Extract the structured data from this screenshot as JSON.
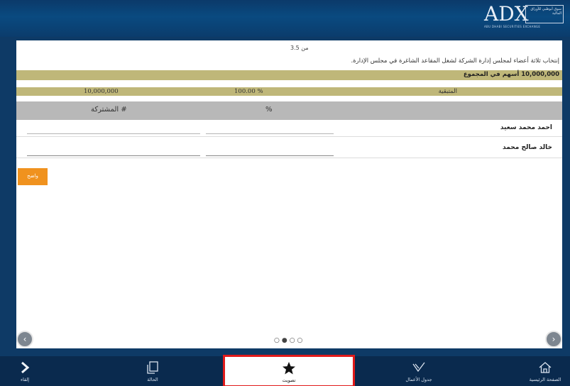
{
  "header": {
    "logo_text": "ADX",
    "logo_box_text": "سوق أبوظبي للأوراق المالية",
    "logo_sub": "ABU DHABI SECURITIES EXCHANGE"
  },
  "panel": {
    "page_indicator": "3.5 من",
    "question": "إنتخاب ثلاثة أعضاء لمجلس إدارة الشركة لشغل المقاعد الشاغرة في مجلس الإدارة.",
    "shares_total": "10,000,000 أسهم في المجموع",
    "remaining_label": "المتبقية",
    "remaining_percent": "100.00 %",
    "remaining_shares": "10,000,000",
    "col_participation": "# المشتركة",
    "col_percent": "%",
    "candidates": [
      {
        "name": "احمد محمد سعيد",
        "shares": "",
        "percent": ""
      },
      {
        "name": "خالد صالح محمد",
        "shares": "",
        "percent": ""
      }
    ],
    "submit_label": "واضح"
  },
  "pager": {
    "dots": "○●○○",
    "prev_arrow": "‹",
    "next_arrow": "›"
  },
  "tabbar": {
    "exit_label": "إلقاء",
    "status_label": "الحالة",
    "vote_label": "تصويت",
    "agenda_label": "جدول الأعمال",
    "home_label": "الصفحة الرئيسية"
  },
  "colors": {
    "header_blue": "#0b3a6a",
    "gold_bar": "#bfb779",
    "table_header": "#b8b8b8",
    "submit_orange": "#f0921e",
    "tabbar": "#0a2a4e",
    "highlight_red": "#e11a1a"
  },
  "icons": [
    "chevron-right-icon",
    "windows-icon",
    "star-icon",
    "checkmark-icon",
    "home-icon"
  ]
}
